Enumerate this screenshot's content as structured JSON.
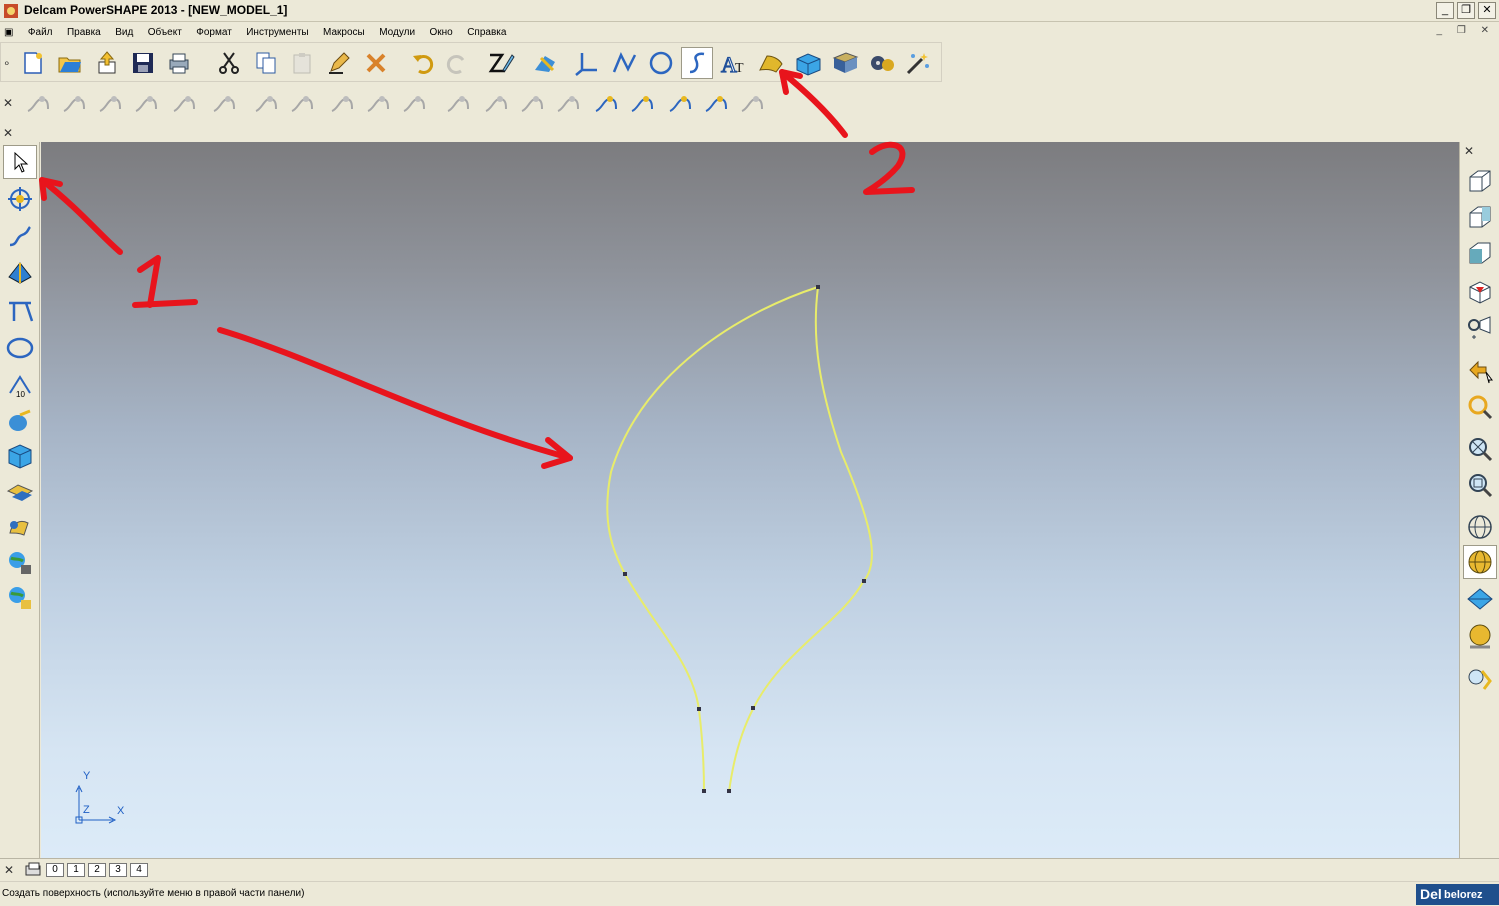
{
  "window": {
    "title": "Delcam PowerSHAPE 2013 - [NEW_MODEL_1]",
    "buttons": [
      "minimize",
      "restore",
      "close"
    ]
  },
  "menu": {
    "items": [
      "Файл",
      "Правка",
      "Вид",
      "Объект",
      "Формат",
      "Инструменты",
      "Макросы",
      "Модули",
      "Окно",
      "Справка"
    ]
  },
  "toolbar_main": {
    "icons": [
      "new-model-icon",
      "open-icon",
      "import-icon",
      "save-icon",
      "print-icon",
      "cut-icon",
      "copy-icon",
      "paste-icon",
      "edit-selection-icon",
      "delete-icon",
      "undo-icon",
      "redo-icon",
      "workplane-icon",
      "dimension-icon",
      "axis-icon",
      "line-icon",
      "arc-icon",
      "curve-icon",
      "text-icon",
      "surface-icon",
      "solid-icon",
      "electrode-icon",
      "tool-icon",
      "wizard-icon"
    ],
    "active": "curve-icon"
  },
  "toolbar_curves": {
    "icons": [
      "curve-editor-icon",
      "trim-curve-icon",
      "blend-curve-icon",
      "fillet-curve-icon",
      "split-curve-icon",
      "reverse-curve-icon",
      "wrap-curve-icon",
      "project-curve-icon",
      "offset-curve-icon",
      "extend-curve-icon",
      "smooth-curve-icon",
      "composite-curve-icon",
      "composite-edit-icon",
      "break-curve-icon",
      "curve-degree-icon",
      "intersect-curve-icon",
      "curve-dims-icon",
      "curve-tangent-icon",
      "curve-align-icon",
      "curve-repoint-icon"
    ]
  },
  "left_toolbar": {
    "icons": [
      "select-icon",
      "transform-icon",
      "curve-tool-icon",
      "surface-tool-icon",
      "line-tool-icon",
      "circle-tool-icon",
      "dimension-tool-icon",
      "solid-tool-icon",
      "box-tool-icon",
      "surface-edit-icon",
      "electrode-tool-icon",
      "globe-tool-icon",
      "globe-edit-icon"
    ],
    "active": "select-icon"
  },
  "right_toolbar": {
    "icons": [
      "view-iso1-icon",
      "view-iso2-icon",
      "view-iso3-icon",
      "view-iso4-icon",
      "view-camera-icon",
      "undo-view-icon",
      "zoom-previous-icon",
      "zoom-fit-icon",
      "zoom-box-icon",
      "wireframe-icon",
      "shaded-icon",
      "shading-mode-icon",
      "render-icon",
      "lighting-icon"
    ],
    "active": "shaded-icon"
  },
  "viewport": {
    "axis": {
      "y": "Y",
      "z": "Z",
      "x": "X"
    },
    "curve_color": "#e8ec6a",
    "annotations": [
      "1",
      "2"
    ],
    "annotation_color": "#e8141c"
  },
  "levels_tabs": [
    "0",
    "1",
    "2",
    "3",
    "4"
  ],
  "status": {
    "text": "Создать поверхность (используйте меню в правой части панели)",
    "logo_prefix": "Del",
    "logo_user": "belorez"
  }
}
